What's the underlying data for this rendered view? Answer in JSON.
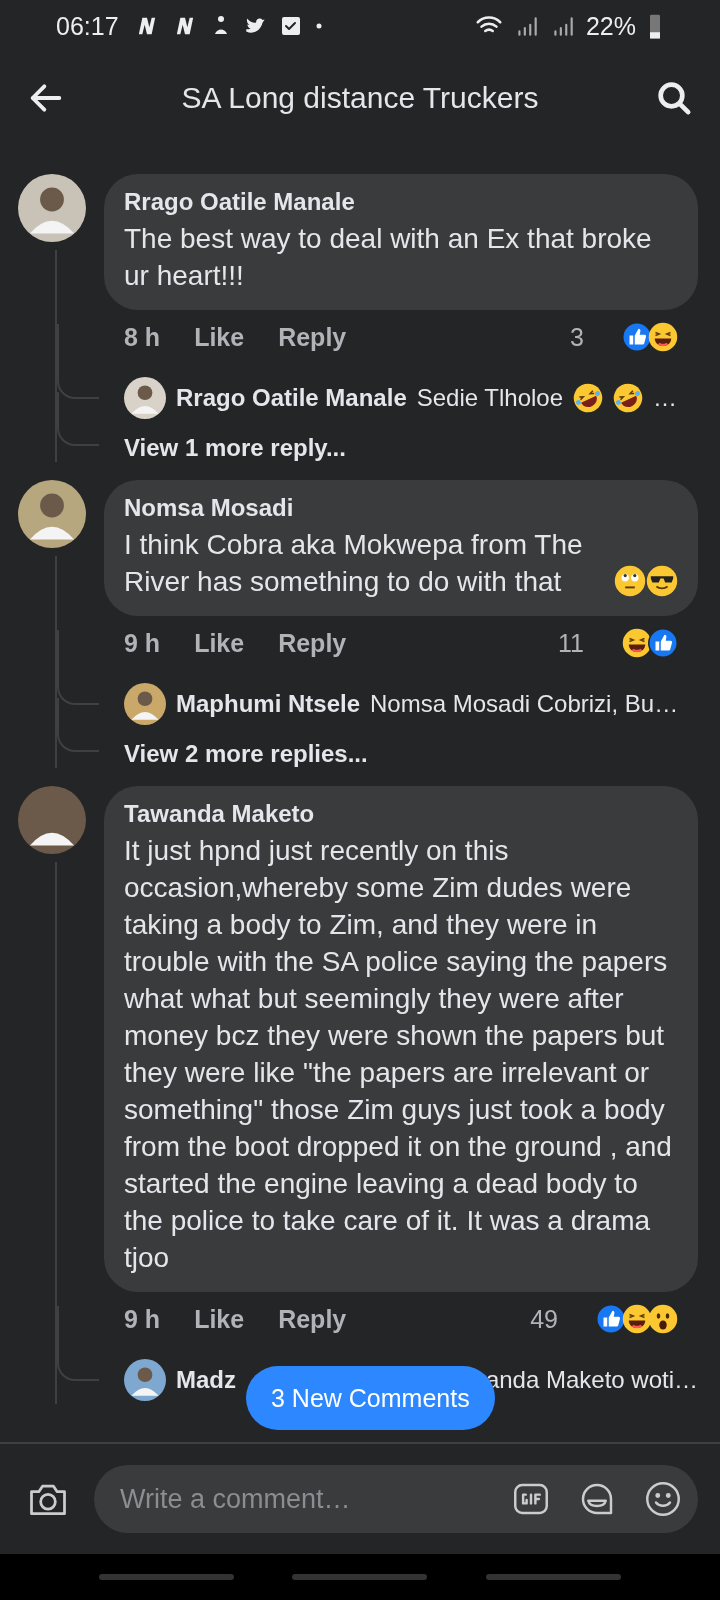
{
  "status_bar": {
    "time": "06:17",
    "battery": "22%"
  },
  "header": {
    "title": "SA Long distance Truckers"
  },
  "comments": [
    {
      "author": "Rrago Oatile Manale",
      "text": "The best way to deal with an Ex that broke ur heart!!!",
      "time": "8 h",
      "actions": [
        "Like",
        "Reply"
      ],
      "reaction_count": "3",
      "reactions": [
        {
          "kind": "like"
        },
        {
          "kind": "haha"
        }
      ],
      "replies": [
        {
          "author": "Rrago Oatile Manale",
          "text": "Sedie Tlholoe",
          "emojis": [
            {
              "kind": "rofl"
            },
            {
              "kind": "rofl"
            }
          ],
          "tail": "…"
        }
      ],
      "more": "View 1 more reply..."
    },
    {
      "author": "Nomsa Mosadi",
      "text": "I think Cobra aka Mokwepa from The River has something to do with that",
      "emojis": [
        {
          "kind": "eyeroll"
        },
        {
          "kind": "cool"
        }
      ],
      "time": "9 h",
      "actions": [
        "Like",
        "Reply"
      ],
      "reaction_count": "11",
      "reactions": [
        {
          "kind": "haha"
        },
        {
          "kind": "like"
        }
      ],
      "replies": [
        {
          "author": "Maphumi Ntsele",
          "text": "Nomsa Mosadi Cobrizi, Bu…"
        }
      ],
      "more": "View 2 more replies..."
    },
    {
      "author": "Tawanda Maketo",
      "text": "It just hpnd just recently on this occasion,whereby some Zim dudes were taking a body to Zim, and they were in trouble with the SA police saying the papers what what but seemingly they were after money bcz they were shown the papers but they were like \"the papers are irrelevant or something\"  those Zim guys just took a body from the boot dropped it on the ground , and started the engine leaving a dead body to the police to take care of it. It was a drama tjoo",
      "time": "9 h",
      "actions": [
        "Like",
        "Reply"
      ],
      "reaction_count": "49",
      "reactions": [
        {
          "kind": "like"
        },
        {
          "kind": "haha"
        },
        {
          "kind": "wow"
        }
      ],
      "replies": [
        {
          "author": "Madz",
          "text": "anda Maketo woti…",
          "covered": true
        }
      ]
    }
  ],
  "new_comments": "3 New Comments",
  "composer": {
    "placeholder": "Write a comment…"
  }
}
